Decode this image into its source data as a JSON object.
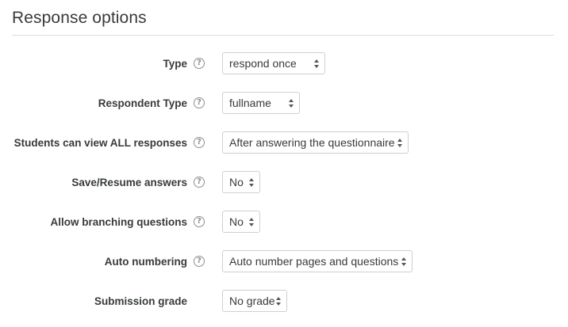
{
  "section": {
    "title": "Response options"
  },
  "fields": [
    {
      "label": "Type",
      "value": "respond once",
      "has_help": true
    },
    {
      "label": "Respondent Type",
      "value": "fullname",
      "has_help": true
    },
    {
      "label": "Students can view ALL responses",
      "value": "After answering the questionnaire",
      "has_help": true
    },
    {
      "label": "Save/Resume answers",
      "value": "No",
      "has_help": true
    },
    {
      "label": "Allow branching questions",
      "value": "No",
      "has_help": true
    },
    {
      "label": "Auto numbering",
      "value": "Auto number pages and questions",
      "has_help": true
    },
    {
      "label": "Submission grade",
      "value": "No grade",
      "has_help": false
    }
  ],
  "help_icon": {
    "glyph": "?",
    "name": "help-icon"
  },
  "colors": {
    "text": "#373a3c",
    "border": "#cfcfcf",
    "help": "#8e8e8e",
    "rule": "#dcdcdc"
  }
}
